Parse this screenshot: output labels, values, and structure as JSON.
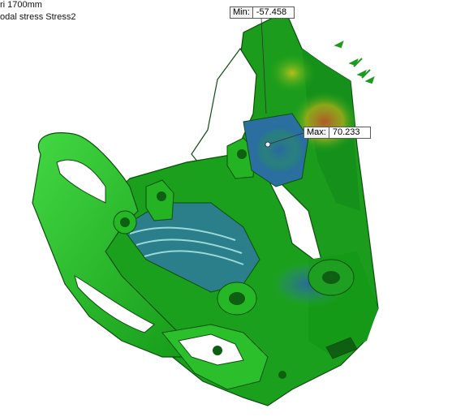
{
  "view_info": {
    "line1": "ri 1700mm",
    "line2": "odal stress Stress2"
  },
  "probes": {
    "min": {
      "label": "Min:",
      "value": "-57.458"
    },
    "max": {
      "label": "Max:",
      "value": "70.233"
    }
  },
  "colors": {
    "base_green": "#1fa81f",
    "light_green": "#3fd43f",
    "dark_green": "#0f6d12",
    "stress_blue": "#2c6fa8",
    "stress_yellow": "#c8c21a",
    "stress_red": "#c0502a",
    "background": "#ffffff"
  }
}
